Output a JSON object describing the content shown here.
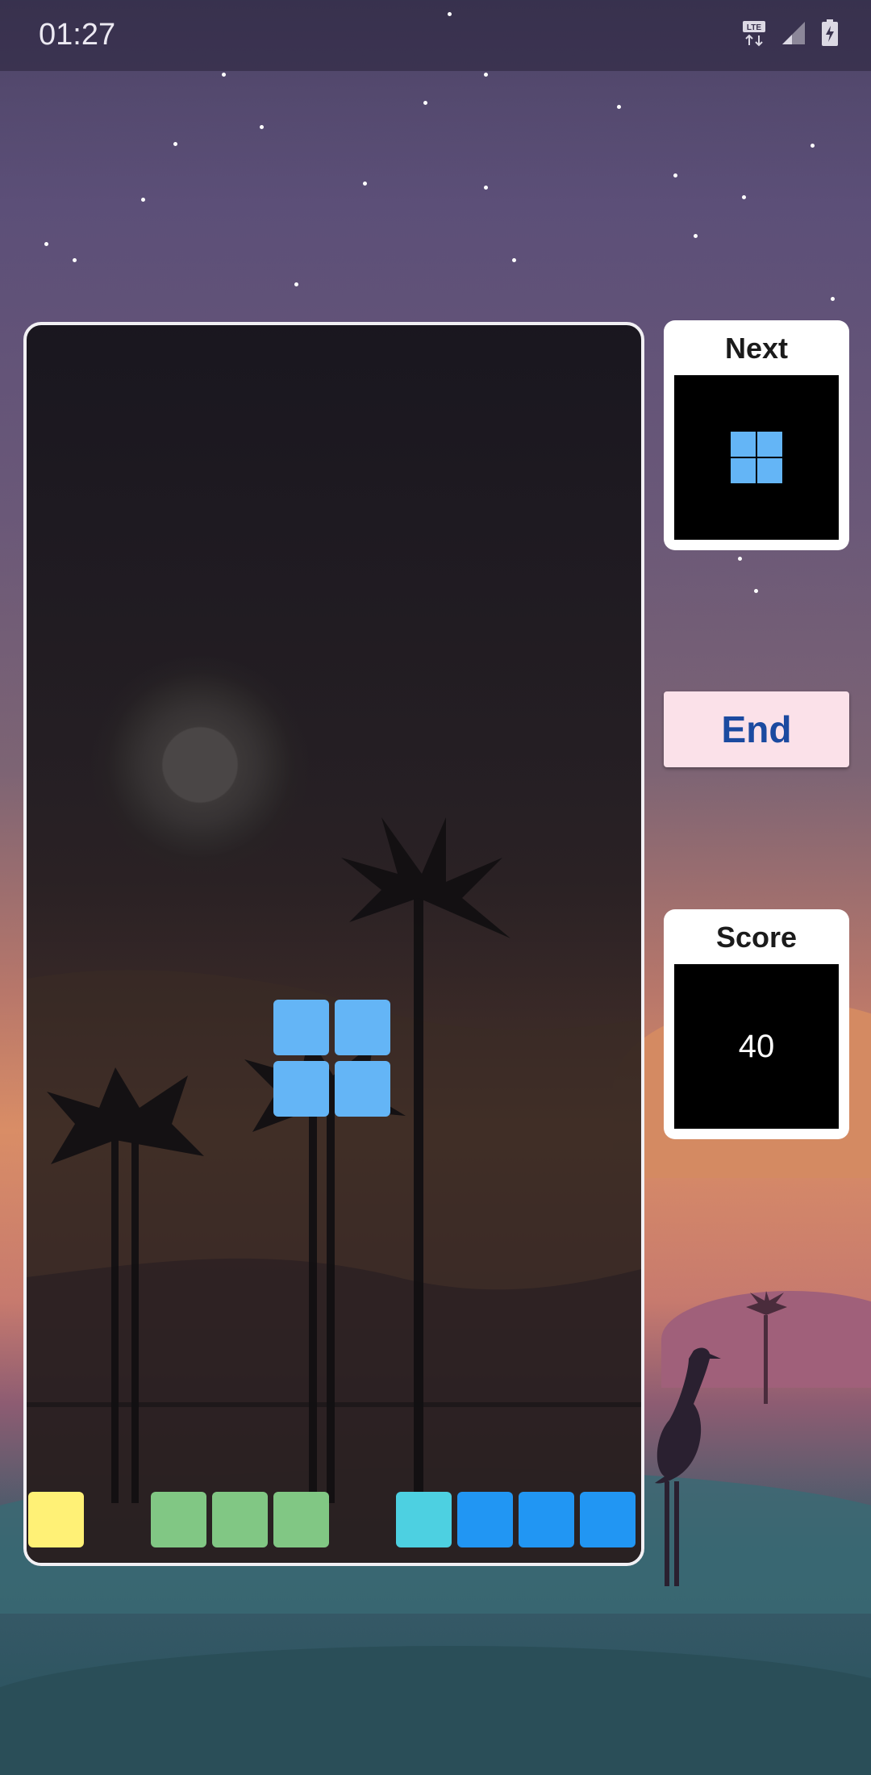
{
  "status_bar": {
    "time": "01:27",
    "icons": [
      "lte-icon",
      "signal-icon",
      "battery-charging-icon"
    ],
    "lte_label": "LTE"
  },
  "board": {
    "columns": 10,
    "active_piece": {
      "shape": "O",
      "color": "#64b5f6"
    },
    "bottom_row": [
      {
        "col": 0,
        "color": "#fff176"
      },
      {
        "col": 2,
        "color": "#81c784"
      },
      {
        "col": 3,
        "color": "#81c784"
      },
      {
        "col": 4,
        "color": "#81c784"
      },
      {
        "col": 6,
        "color": "#4dd0e1"
      },
      {
        "col": 7,
        "color": "#2196f3"
      },
      {
        "col": 8,
        "color": "#2196f3"
      },
      {
        "col": 9,
        "color": "#2196f3"
      }
    ]
  },
  "next_panel": {
    "title": "Next",
    "piece": {
      "shape": "O",
      "color": "#64b5f6"
    }
  },
  "end_button": {
    "label": "End"
  },
  "score_panel": {
    "title": "Score",
    "value": "40"
  },
  "colors": {
    "panel_bg": "#ffffff",
    "button_bg": "#fbe1e9",
    "button_text": "#1b4aa0"
  }
}
